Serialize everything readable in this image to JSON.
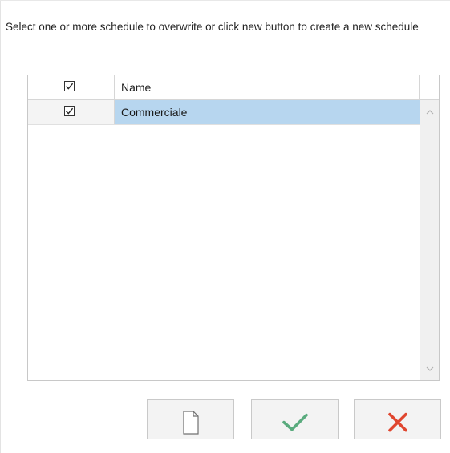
{
  "instructions": "Select one or more schedule to overwrite or click new button to create a new schedule",
  "grid": {
    "header": {
      "select_all_checked": true,
      "name_column": "Name"
    },
    "rows": [
      {
        "checked": true,
        "name": "Commerciale",
        "selected": true
      }
    ]
  },
  "buttons": {
    "new": {
      "icon": "new-document-icon"
    },
    "confirm": {
      "icon": "checkmark-icon",
      "color": "#5aab7e"
    },
    "cancel": {
      "icon": "close-icon",
      "color": "#e0462f"
    }
  },
  "colors": {
    "selection": "#b7d6ef",
    "border": "#c8c8c8"
  }
}
